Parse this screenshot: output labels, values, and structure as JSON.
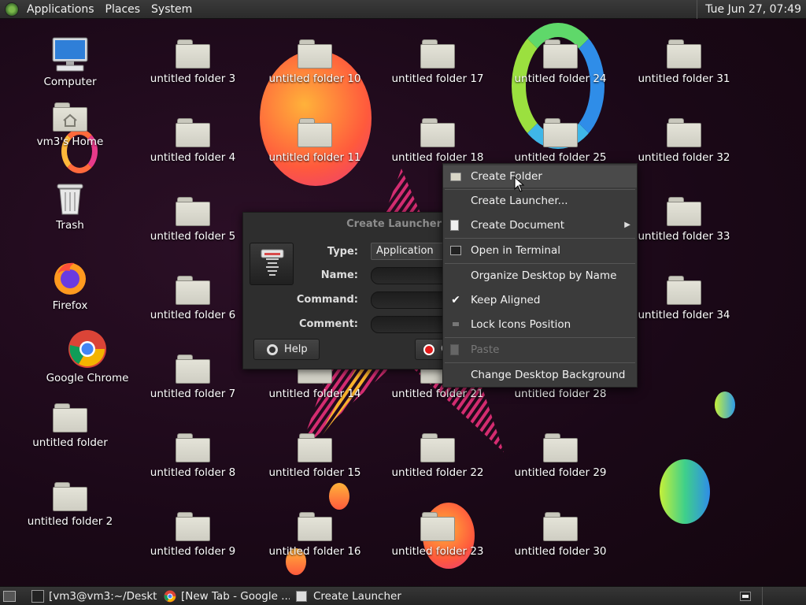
{
  "top_panel": {
    "menus": [
      "Applications",
      "Places",
      "System"
    ],
    "clock": "Tue Jun 27, 07:49"
  },
  "desktop": {
    "system_icons": [
      {
        "label": "Computer",
        "icon": "computer-icon"
      },
      {
        "label": "vm3's Home",
        "icon": "home-folder-icon"
      },
      {
        "label": "Trash",
        "icon": "trash-icon"
      },
      {
        "label": "Firefox",
        "icon": "firefox-icon"
      },
      {
        "label": "Google Chrome",
        "icon": "chrome-icon"
      }
    ],
    "folders": [
      "untitled folder",
      "untitled folder 2",
      "untitled folder 3",
      "untitled folder 4",
      "untitled folder 5",
      "untitled folder 6",
      "untitled folder 7",
      "untitled folder 8",
      "untitled folder 9",
      "untitled folder 10",
      "untitled folder 11",
      "untitled folder 14",
      "untitled folder 15",
      "untitled folder 16",
      "untitled folder 17",
      "untitled folder 18",
      "untitled folder 21",
      "untitled folder 22",
      "untitled folder 23",
      "untitled folder 24",
      "untitled folder 25",
      "untitled folder 28",
      "untitled folder 29",
      "untitled folder 30",
      "untitled folder 31",
      "untitled folder 32",
      "untitled folder 33",
      "untitled folder 34"
    ]
  },
  "dialog": {
    "title": "Create Launcher",
    "type_label": "Type:",
    "type_value": "Application",
    "name_label": "Name:",
    "name_value": "",
    "command_label": "Command:",
    "command_value": "",
    "comment_label": "Comment:",
    "comment_value": "",
    "help_button": "Help",
    "cancel_button": "C"
  },
  "context_menu": {
    "items": [
      {
        "label": "Create Folder",
        "icon": "new-folder-icon",
        "enabled": true
      },
      {
        "label": "Create Launcher...",
        "icon": "",
        "enabled": true
      },
      {
        "label": "Create Document",
        "icon": "new-document-icon",
        "enabled": true,
        "submenu": true
      },
      {
        "label": "Open in Terminal",
        "icon": "terminal-icon",
        "enabled": true
      },
      {
        "label": "Organize Desktop by Name",
        "icon": "",
        "enabled": true
      },
      {
        "label": "Keep Aligned",
        "icon": "checkmark-icon",
        "enabled": true,
        "checked": true
      },
      {
        "label": "Lock Icons Position",
        "icon": "unchecked-icon",
        "enabled": true,
        "checked": false
      },
      {
        "label": "Paste",
        "icon": "paste-icon",
        "enabled": false
      },
      {
        "label": "Change Desktop Background",
        "icon": "",
        "enabled": true
      }
    ]
  },
  "taskbar": {
    "tasks": [
      {
        "label": "[vm3@vm3:~/Deskt...",
        "icon": "terminal-icon"
      },
      {
        "label": "[New Tab - Google ...",
        "icon": "chrome-icon"
      },
      {
        "label": "Create Launcher",
        "icon": "launcher-icon"
      }
    ]
  },
  "colors": {
    "wallpaper": "#1a0817",
    "panel": "#2f2f2f",
    "menu": "#3b3b3b"
  }
}
